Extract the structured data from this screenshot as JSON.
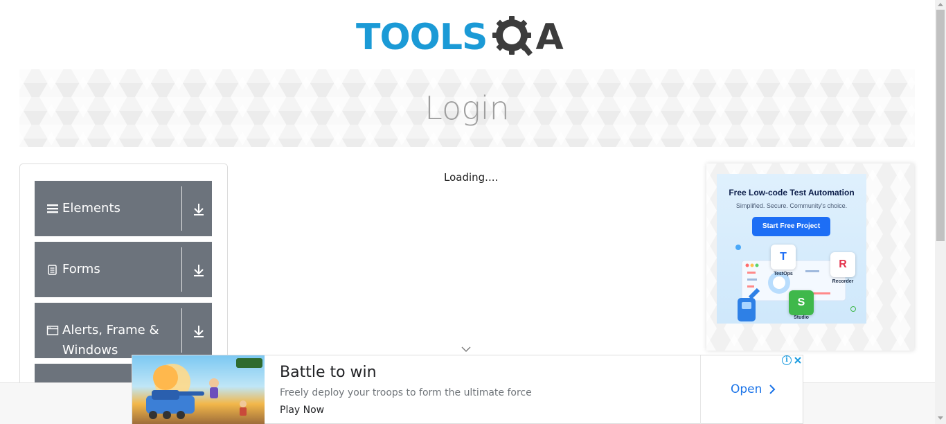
{
  "logo": {
    "text_left": "TOOLS",
    "text_right": "A"
  },
  "page_title": "Login",
  "sidebar": {
    "groups": [
      {
        "label": "Elements",
        "icon": "hamburger-icon"
      },
      {
        "label": "Forms",
        "icon": "document-icon"
      },
      {
        "label": "Alerts, Frame & Windows",
        "icon": "window-icon"
      },
      {
        "label": "",
        "icon": ""
      }
    ]
  },
  "main": {
    "loading_text": "Loading...."
  },
  "side_ad": {
    "title": "Free Low-code Test Automation",
    "subtitle": "Simplified. Secure. Community's choice.",
    "cta": "Start Free Project",
    "tiles": [
      "TestOps",
      "Recorder",
      "Studio"
    ]
  },
  "bottom_ad": {
    "headline": "Battle to win",
    "description": "Freely deploy your troops to form the ultimate force",
    "cta_secondary": "Play Now",
    "cta_primary": "Open"
  },
  "colors": {
    "brand_blue": "#1b9ad6",
    "sidebar_group": "#6c737c",
    "ad_link": "#1a73e8"
  }
}
